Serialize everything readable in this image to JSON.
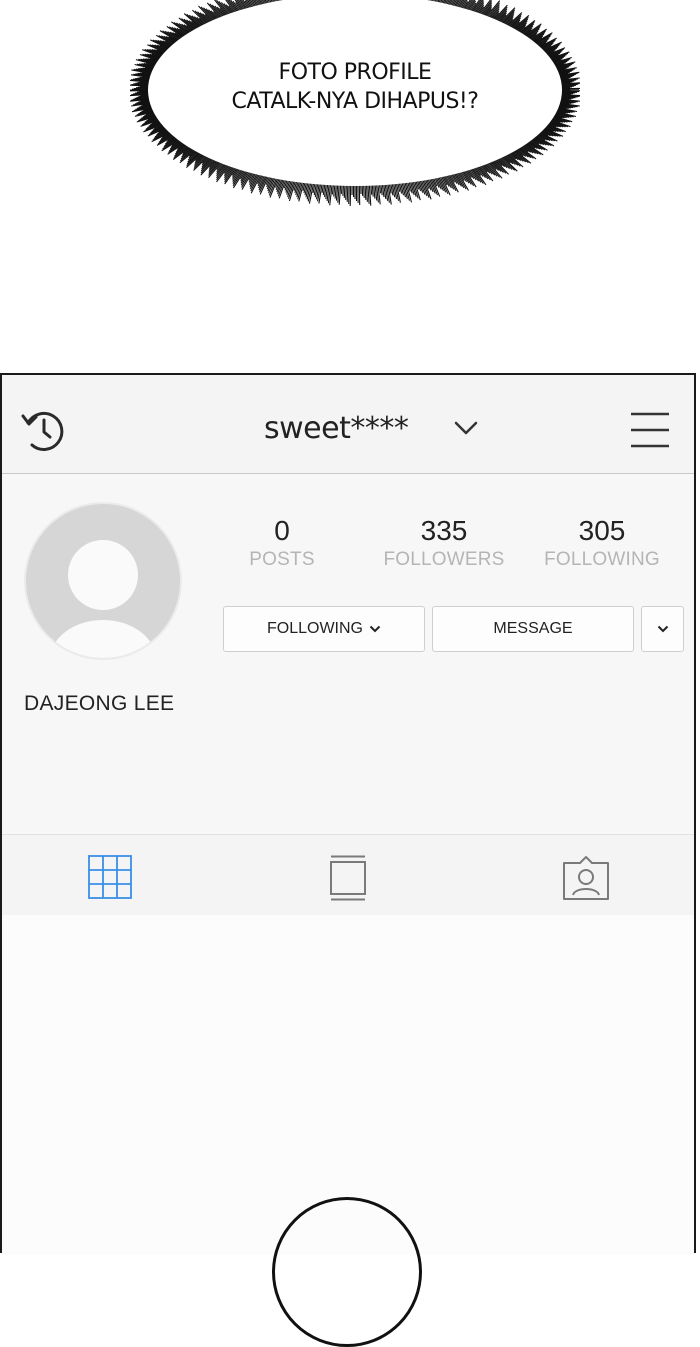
{
  "bubble": {
    "line1": "FOTO PROFILE",
    "line2": "CATALK-NYA DIHAPUS!?"
  },
  "header": {
    "username": "sweet****",
    "icons": [
      "history-icon",
      "chevron-down-icon",
      "menu-icon"
    ]
  },
  "profile": {
    "stats": [
      {
        "value": "0",
        "label": "POSTS"
      },
      {
        "value": "335",
        "label": "FOLLOWERS"
      },
      {
        "value": "305",
        "label": "FOLLOWING"
      }
    ],
    "buttons": {
      "following": "FOLLOWING",
      "message": "MESSAGE"
    },
    "name": "DAJEONG LEE"
  },
  "tabs": [
    {
      "icon": "grid-icon",
      "active": true
    },
    {
      "icon": "list-icon",
      "active": false
    },
    {
      "icon": "tagged-icon",
      "active": false
    }
  ],
  "colors": {
    "active_tab": "#3a8fe8",
    "inactive_icon": "#7a7a7a"
  }
}
